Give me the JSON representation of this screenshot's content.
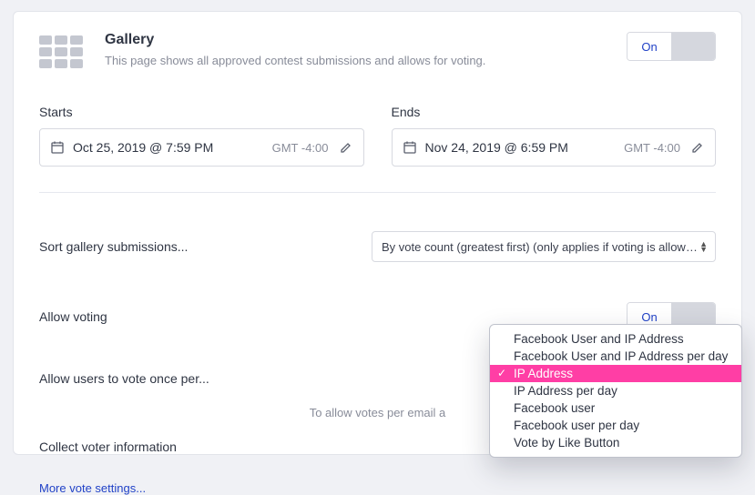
{
  "header": {
    "title": "Gallery",
    "subtitle": "This page shows all approved contest submissions and allows for voting.",
    "toggle_label": "On"
  },
  "dates": {
    "starts_label": "Starts",
    "ends_label": "Ends",
    "starts_value": "Oct 25, 2019 @ 7:59 PM",
    "ends_value": "Nov 24, 2019 @ 6:59 PM",
    "starts_tz": "GMT -4:00",
    "ends_tz": "GMT -4:00"
  },
  "sort": {
    "label": "Sort gallery submissions...",
    "value": "By vote count (greatest first) (only applies if voting is allowed)"
  },
  "allow_voting": {
    "label": "Allow voting",
    "toggle_label": "On"
  },
  "vote_once": {
    "label": "Allow users to vote once per...",
    "options": [
      "Facebook User and IP Address",
      "Facebook User and IP Address per day",
      "IP Address",
      "IP Address per day",
      "Facebook user",
      "Facebook user per day",
      "Vote by Like Button"
    ],
    "selected_index": 2
  },
  "email_hint": "To allow votes per email a",
  "collect": {
    "label": "Collect voter information"
  },
  "more_link": "More vote settings..."
}
